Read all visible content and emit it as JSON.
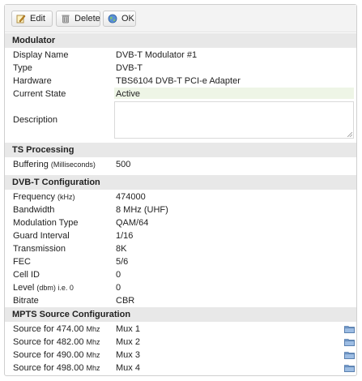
{
  "toolbar": {
    "edit_label": "Edit",
    "delete_label": "Delete",
    "ok_label": "OK"
  },
  "sections": {
    "modulator": "Modulator",
    "ts_processing": "TS Processing",
    "dvbt_config": "DVB-T Configuration",
    "mpts_config": "MPTS Source Configuration"
  },
  "modulator": {
    "display_name_label": "Display Name",
    "display_name": "DVB-T Modulator #1",
    "type_label": "Type",
    "type": "DVB-T",
    "hardware_label": "Hardware",
    "hardware": "TBS6104 DVB-T PCI-e Adapter",
    "state_label": "Current State",
    "state": "Active",
    "description_label": "Description",
    "description": ""
  },
  "ts": {
    "buffering_label": "Buffering",
    "buffering_unit": "(Milliseconds)",
    "buffering": "500"
  },
  "dvbt": {
    "frequency_label": "Frequency",
    "frequency_unit": "(kHz)",
    "frequency": "474000",
    "bandwidth_label": "Bandwidth",
    "bandwidth": "8 MHz (UHF)",
    "modulation_label": "Modulation Type",
    "modulation": "QAM/64",
    "guard_label": "Guard Interval",
    "guard": "1/16",
    "transmission_label": "Transmission",
    "transmission": "8K",
    "fec_label": "FEC",
    "fec": "5/6",
    "cellid_label": "Cell ID",
    "cellid": "0",
    "level_label": "Level",
    "level_unit": "(dbm) i.e. 0",
    "level": "0",
    "bitrate_label": "Bitrate",
    "bitrate": "CBR"
  },
  "mpts": {
    "rows": [
      {
        "label": "Source for 474.00",
        "unit": "Mhz",
        "value": "Mux 1"
      },
      {
        "label": "Source for 482.00",
        "unit": "Mhz",
        "value": "Mux 2"
      },
      {
        "label": "Source for 490.00",
        "unit": "Mhz",
        "value": "Mux 3"
      },
      {
        "label": "Source for 498.00",
        "unit": "Mhz",
        "value": "Mux 4"
      }
    ]
  },
  "colors": {
    "section_bg": "#e8e8e8",
    "active_bg": "#eef5e6",
    "folder": "#7fa6d6"
  },
  "icons": {
    "edit": "edit-pencil-icon",
    "delete": "trash-icon",
    "ok": "ok-globe-icon",
    "picker": "folder-icon"
  }
}
